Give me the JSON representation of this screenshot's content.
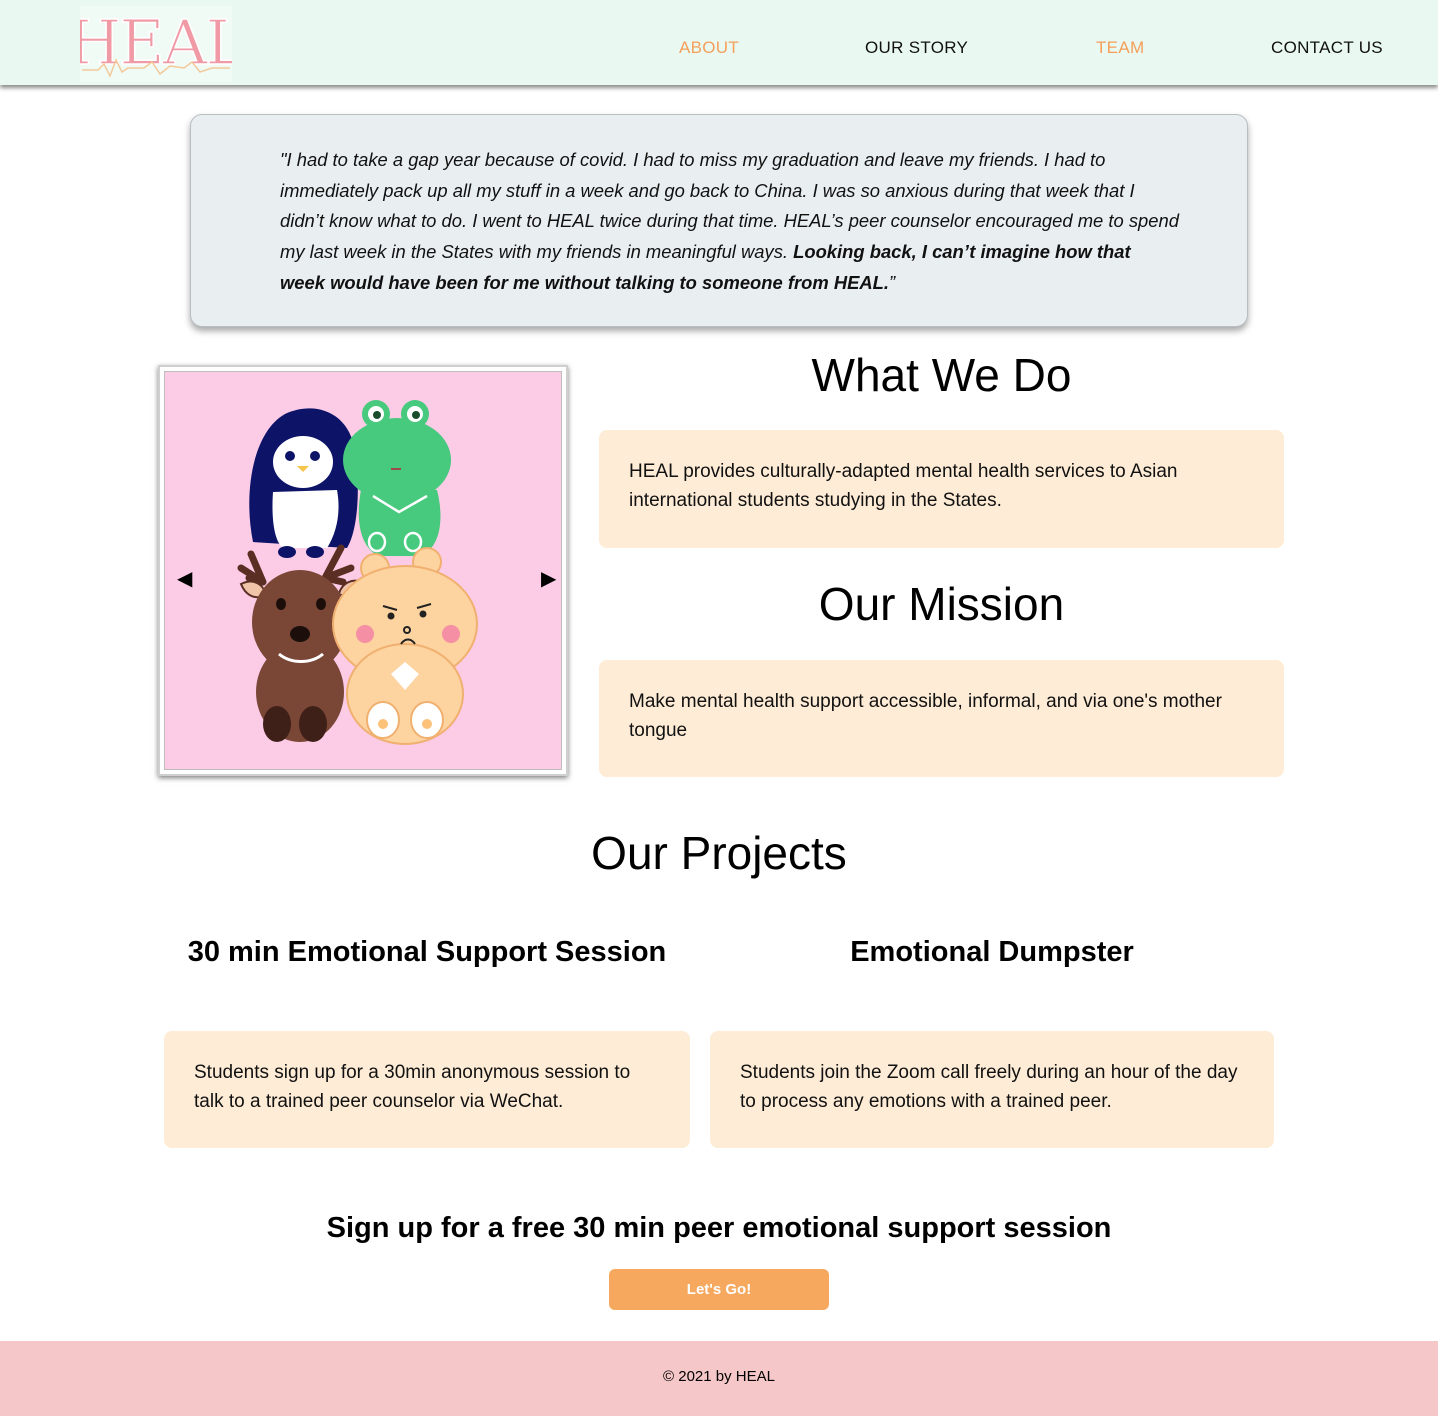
{
  "brand": {
    "logo_text": "HEAL",
    "accent_color": "#f4a05a",
    "header_bg": "#e9f9f1",
    "footer_bg": "#f5c7c8",
    "box_bg": "#feecd6"
  },
  "nav": {
    "items": [
      {
        "label": "ABOUT",
        "color": "#f4a05a"
      },
      {
        "label": "OUR STORY",
        "color": "#111111"
      },
      {
        "label": "TEAM",
        "color": "#f4a05a"
      },
      {
        "label": "CONTACT US",
        "color": "#111111"
      }
    ]
  },
  "testimonial": {
    "text_regular": "\"I had to take a gap year because of covid. I had to miss my graduation and leave my friends. I had to immediately pack up all my stuff in a week and go back to China. I was so anxious during that week that I didn’t know what to do. I went to HEAL twice during that time. HEAL’s peer counselor encouraged me to spend my last week in the States with my friends in meaningful ways. ",
    "text_bold": "Looking back, I can’t imagine how that week would have been for me without talking to someone from HEAL.",
    "text_end": "”"
  },
  "slideshow": {
    "prev_icon": "left-triangle-icon",
    "next_icon": "right-triangle-icon",
    "prev_glyph": "◀",
    "next_glyph": "▶"
  },
  "what_we_do": {
    "title": "What We Do",
    "body": "HEAL provides culturally-adapted mental health services to Asian international students studying in the States."
  },
  "mission": {
    "title": "Our Mission",
    "body": "Make mental health support accessible, informal, and via one's mother tongue"
  },
  "projects": {
    "title": "Our Projects",
    "items": [
      {
        "title": "30 min Emotional Support Session",
        "body": "Students sign up for a 30min anonymous session to talk to a trained peer counselor via WeChat."
      },
      {
        "title": "Emotional Dumpster",
        "body": "Students join the Zoom call freely during an hour of the day to process any emotions with a trained peer."
      }
    ]
  },
  "cta": {
    "title": "Sign up for a free 30 min peer emotional support session",
    "button_label": "Let's Go!"
  },
  "footer": {
    "copyright": "© 2021 by HEAL"
  }
}
